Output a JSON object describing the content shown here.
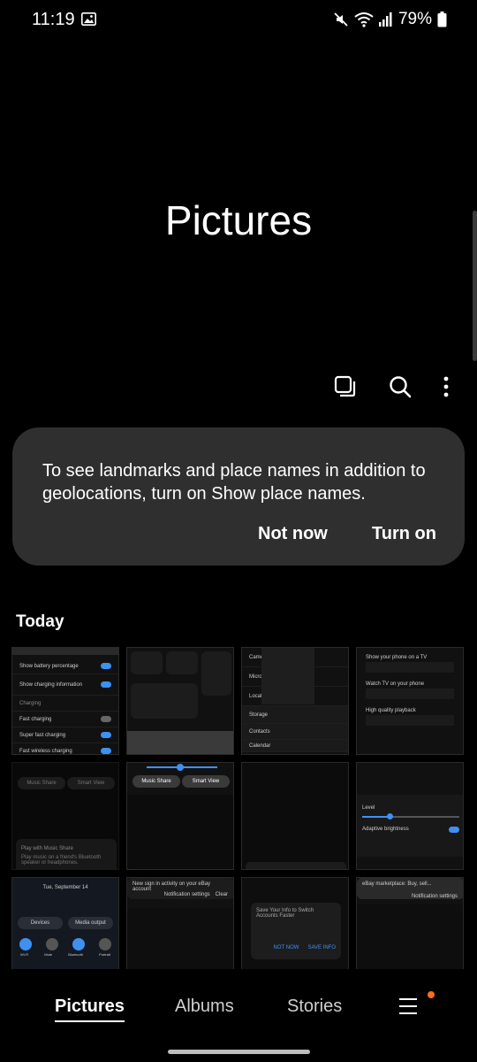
{
  "status_bar": {
    "time": "11:19",
    "battery": "79%",
    "icons": [
      "gallery-notification-icon",
      "mute-icon",
      "wifi-icon",
      "signal-icon",
      "battery-icon"
    ]
  },
  "page": {
    "title": "Pictures"
  },
  "toolbar": {
    "icons": [
      "select-icon",
      "search-icon",
      "more-options-icon"
    ]
  },
  "info_card": {
    "message": "To see landmarks and place names in addition to geolocations, turn on Show place names.",
    "dismiss_label": "Not now",
    "confirm_label": "Turn on"
  },
  "section": {
    "title": "Today"
  },
  "thumbnails": {
    "t1": {
      "rows": [
        "Show battery percentage",
        "Show charging information",
        "Charging",
        "Fast charging",
        "Super fast charging",
        "Fast wireless charging"
      ]
    },
    "t3": {
      "rows": [
        "Camera",
        "Microphone",
        "Location",
        "Storage",
        "Contacts",
        "Calendar"
      ]
    },
    "t4": {
      "items": [
        "Show your phone on a TV",
        "Watch TV on your phone",
        "High quality playback"
      ]
    },
    "t5": {
      "labels": [
        "Music Share",
        "Smart View"
      ],
      "card_title": "Play with Music Share",
      "card_text": "Play music on a friend's Bluetooth speaker or headphones."
    },
    "t6": {
      "labels": [
        "Music Share",
        "Smart View"
      ]
    },
    "t8": {
      "labels": [
        "Level",
        "Adaptive brightness"
      ]
    },
    "t9": {
      "date": "Tue, September 14",
      "buttons": [
        "Devices",
        "Media output"
      ],
      "toggles": [
        "Wi-Fi",
        "Mute",
        "Bluetooth",
        "Portrait"
      ]
    },
    "t10": {
      "lines": [
        "New sign in activity on your eBay account",
        "Notification settings",
        "Clear"
      ]
    },
    "t11": {
      "title": "Save Your Info to Switch Accounts Faster",
      "buttons": [
        "NOT NOW",
        "SAVE INFO"
      ]
    },
    "t12": {
      "lines": [
        "eBay marketplace: Buy, sell...",
        "Notification settings"
      ]
    }
  },
  "bottom_nav": {
    "tabs": [
      "Pictures",
      "Albums",
      "Stories"
    ],
    "active_tab": "Pictures",
    "has_notification_badge": true
  },
  "colors": {
    "background": "#000000",
    "card": "#2f2f2f",
    "accent": "#3e91f0",
    "badge": "#ff6a1f"
  }
}
